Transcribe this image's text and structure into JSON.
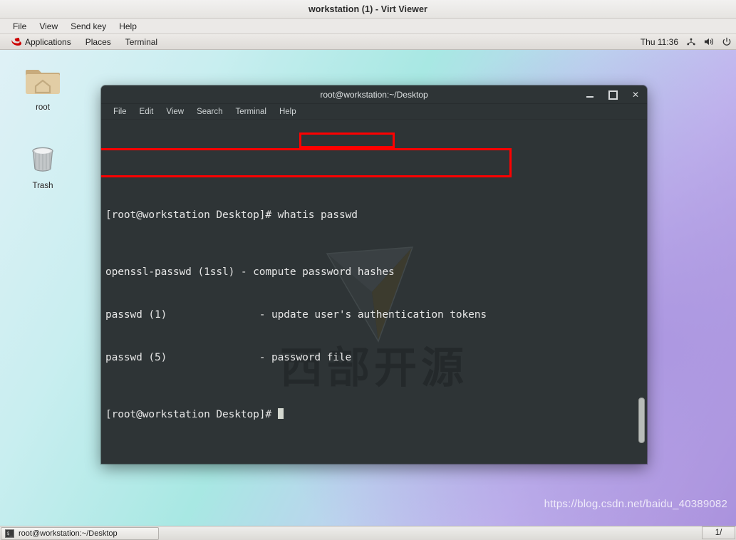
{
  "window": {
    "title": "workstation (1) - Virt Viewer",
    "menu": [
      "File",
      "View",
      "Send key",
      "Help"
    ]
  },
  "gnome_panel": {
    "redhat_icon": "redhat-icon",
    "items": [
      "Applications",
      "Places",
      "Terminal"
    ],
    "clock": "Thu 11:36",
    "tray": [
      {
        "icon": "network-icon",
        "glyph": "⁙"
      },
      {
        "icon": "volume-icon",
        "glyph": "🔊"
      },
      {
        "icon": "power-icon",
        "glyph": "⏻"
      }
    ]
  },
  "desktop": {
    "icons": [
      {
        "name": "home-folder-icon",
        "label": "root"
      },
      {
        "name": "trash-icon",
        "label": "Trash"
      }
    ],
    "wallpaper_text": "西部开源"
  },
  "terminal": {
    "title": "root@workstation:~/Desktop",
    "menu": [
      "File",
      "Edit",
      "View",
      "Search",
      "Terminal",
      "Help"
    ],
    "buttons": {
      "minimize": "minimize-button",
      "maximize": "maximize-button",
      "close": "close-button",
      "close_glyph": "✕"
    },
    "lines": [
      {
        "type": "prompt",
        "prompt": "[root@workstation Desktop]# ",
        "command": "whatis passwd"
      },
      {
        "type": "output",
        "text": "openssl-passwd (1ssl) - compute password hashes"
      },
      {
        "type": "output",
        "text": "passwd (1)               - update user's authentication tokens"
      },
      {
        "type": "output",
        "text": "passwd (5)               - password file"
      },
      {
        "type": "prompt",
        "prompt": "[root@workstation Desktop]# ",
        "command": ""
      }
    ],
    "annotation_color": "#ff0000"
  },
  "taskbar": {
    "task_label": "root@workstation:~/Desktop",
    "task_icon_glyph": "$_",
    "workspace": "1/"
  },
  "watermark": "https://blog.csdn.net/baidu_40389082"
}
